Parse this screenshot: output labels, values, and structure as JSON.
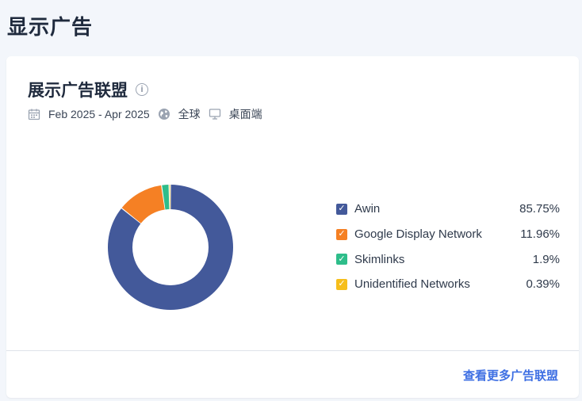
{
  "page": {
    "title": "显示广告"
  },
  "card": {
    "title": "展示广告联盟",
    "info_icon": "info-icon",
    "meta": {
      "date_range": "Feb 2025 - Apr 2025",
      "region": "全球",
      "device": "桌面端"
    },
    "footer_link": "查看更多广告联盟"
  },
  "chart_data": {
    "type": "pie",
    "style": "donut",
    "slices": [
      {
        "name": "Awin",
        "value": 85.75,
        "label": "85.75%",
        "color": "#43599a"
      },
      {
        "name": "Google Display Network",
        "value": 11.96,
        "label": "11.96%",
        "color": "#f58024"
      },
      {
        "name": "Skimlinks",
        "value": 1.9,
        "label": "1.9%",
        "color": "#2ebd8a"
      },
      {
        "name": "Unidentified Networks",
        "value": 0.39,
        "label": "0.39%",
        "color": "#f6be1b"
      }
    ],
    "legend_position": "right"
  }
}
